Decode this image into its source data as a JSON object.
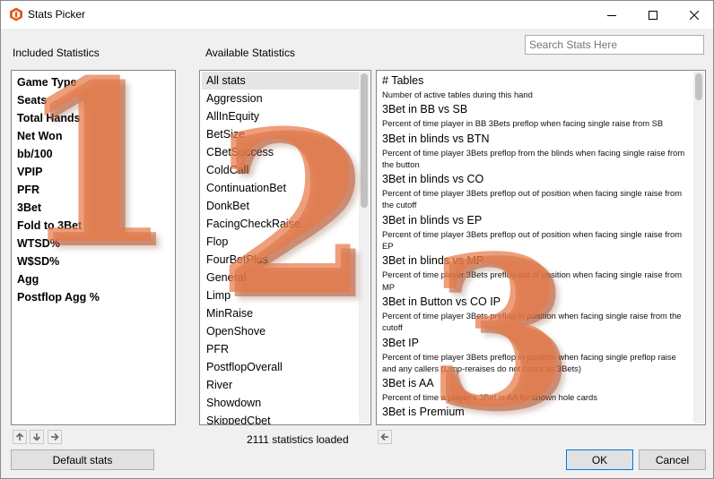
{
  "window": {
    "title": "Stats Picker",
    "brand_color": "#e3551c"
  },
  "search": {
    "placeholder": "Search Stats Here"
  },
  "included": {
    "label": "Included Statistics",
    "items": [
      "Game Type",
      "Seats",
      "Total Hands",
      "Net Won",
      "bb/100",
      "VPIP",
      "PFR",
      "3Bet",
      "Fold to 3Bet",
      "WTSD%",
      "W$SD%",
      "Agg",
      "Postflop Agg %"
    ]
  },
  "available": {
    "label": "Available Statistics",
    "items": [
      "All stats",
      "Aggression",
      "AllInEquity",
      "BetSize",
      "CBetSuccess",
      "ColdCall",
      "ContinuationBet",
      "DonkBet",
      "FacingCheckRaise",
      "Flop",
      "FourBetPlus",
      "General",
      "Limp",
      "MinRaise",
      "OpenShove",
      "PFR",
      "PostflopOverall",
      "River",
      "Showdown",
      "SkippedCbet"
    ],
    "selected_index": 0
  },
  "details": {
    "items": [
      {
        "name": "# Tables",
        "desc": "Number of active tables during this hand"
      },
      {
        "name": "3Bet in BB vs SB",
        "desc": "Percent of time player in BB 3Bets preflop when facing single raise from SB"
      },
      {
        "name": "3Bet in blinds vs BTN",
        "desc": "Percent of time player 3Bets preflop from the blinds when facing single raise from the button"
      },
      {
        "name": "3Bet in blinds vs CO",
        "desc": "Percent of time player 3Bets preflop out of position when facing single raise from the cutoff"
      },
      {
        "name": "3Bet in blinds vs EP",
        "desc": "Percent of time player 3Bets preflop out of position when facing single raise from EP"
      },
      {
        "name": "3Bet in blinds vs MP",
        "desc": "Percent of time player 3Bets preflop out of position when facing single raise from MP"
      },
      {
        "name": "3Bet in Button vs CO IP",
        "desc": "Percent of time player 3Bets preflop in position when facing single raise from the cutoff"
      },
      {
        "name": "3Bet IP",
        "desc": "Percent of time player 3Bets preflop in position when facing single preflop raise and any callers (Limp-reraises do not count as 3Bets)"
      },
      {
        "name": "3Bet is AA",
        "desc": "Percent of time a player's 3Bet is AA for known hole cards"
      },
      {
        "name": "3Bet is Premium",
        "desc": ""
      }
    ]
  },
  "watermarks": [
    "1",
    "2",
    "3"
  ],
  "status": {
    "loaded_text": "2111 statistics loaded"
  },
  "buttons": {
    "default_stats": "Default stats",
    "ok": "OK",
    "cancel": "Cancel"
  }
}
